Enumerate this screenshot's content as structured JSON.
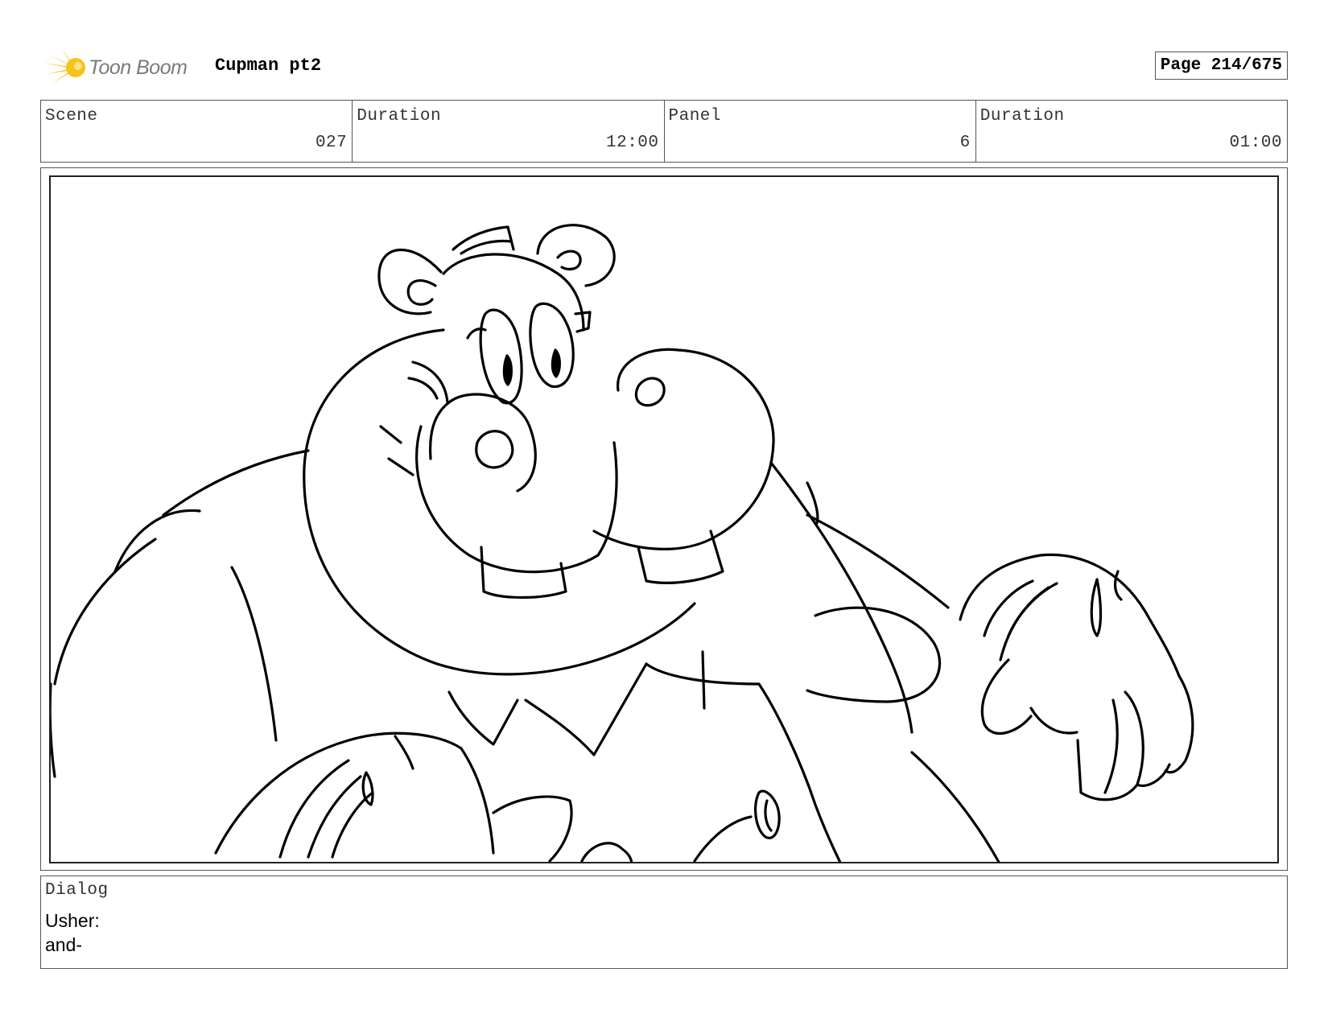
{
  "header": {
    "logo_text": "Toon Boom",
    "project_title": "Cupman pt2",
    "page_label": "Page 214/675"
  },
  "info": {
    "scene_label": "Scene",
    "scene_value": "027",
    "scene_duration_label": "Duration",
    "scene_duration_value": "12:00",
    "panel_label": "Panel",
    "panel_value": "6",
    "panel_duration_label": "Duration",
    "panel_duration_value": "01:00"
  },
  "dialog": {
    "label": "Dialog",
    "lines": [
      "Usher:",
      "and-"
    ]
  },
  "colors": {
    "logo_yellow": "#f7c21b",
    "logo_gray": "#7a7a7a",
    "line": "#000000"
  }
}
